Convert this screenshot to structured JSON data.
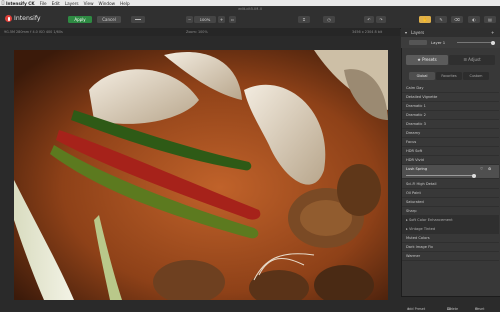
{
  "menubar": {
    "items": [
      "Intensify CK",
      "File",
      "Edit",
      "Layers",
      "View",
      "Window",
      "Help"
    ]
  },
  "toolbar": {
    "doc_title": "edit-cit5.IM-II",
    "app_name": "Intensify",
    "apply_label": "Apply",
    "cancel_label": "Cancel",
    "zoom_value": "100%"
  },
  "infobar": {
    "left_info": "9G.5M    280mm    f 4.0    ISO 400    1/60s",
    "zoom_label": "Zoom: 100%",
    "right_info": "3456 x 2304    8 bit"
  },
  "panel": {
    "header_label": "Layers",
    "layer_name": "Layer 1",
    "tabs": [
      {
        "label": "Presets",
        "active": true
      },
      {
        "label": "Adjust",
        "active": false
      }
    ],
    "subtabs": [
      {
        "label": "Global",
        "active": true
      },
      {
        "label": "Favorites",
        "active": false
      },
      {
        "label": "Custom",
        "active": false
      }
    ],
    "presets": [
      {
        "label": "Calm Day",
        "kind": "item"
      },
      {
        "label": "Detailed Vignette",
        "kind": "item"
      },
      {
        "label": "Dramatic 1",
        "kind": "item"
      },
      {
        "label": "Dramatic 2",
        "kind": "item"
      },
      {
        "label": "Dramatic 3",
        "kind": "item"
      },
      {
        "label": "Dreamy",
        "kind": "item"
      },
      {
        "label": "Focus",
        "kind": "item"
      },
      {
        "label": "HDR Soft",
        "kind": "item"
      },
      {
        "label": "HDR Vivid",
        "kind": "item"
      },
      {
        "label": "Lush Spring",
        "kind": "selected"
      },
      {
        "label": "Sci-Fi High Detail",
        "kind": "item"
      },
      {
        "label": "Oil Paint",
        "kind": "item"
      },
      {
        "label": "Saturated",
        "kind": "item"
      },
      {
        "label": "Sharp",
        "kind": "item"
      },
      {
        "label": "Soft Color Enhancement",
        "kind": "group"
      },
      {
        "label": "Vintage Tinted",
        "kind": "group"
      },
      {
        "label": "Muted Colors",
        "kind": "item"
      },
      {
        "label": "Dark Image Fix",
        "kind": "item"
      },
      {
        "label": "Warmer",
        "kind": "item"
      }
    ],
    "footer": {
      "add_preset": "Add Preset",
      "delete": "Delete",
      "reset": "Reset"
    }
  }
}
